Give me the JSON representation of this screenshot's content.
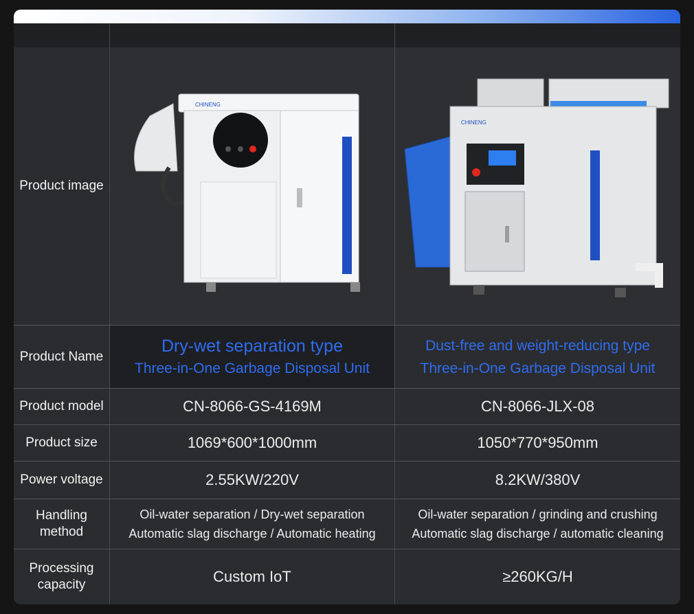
{
  "rows": {
    "image_label": "Product image",
    "name_label": "Product Name",
    "model_label": "Product model",
    "size_label": "Product size",
    "voltage_label": "Power voltage",
    "handling_label_line1": "Handling",
    "handling_label_line2": "method",
    "capacity_label_line1": "Processing",
    "capacity_label_line2": "capacity"
  },
  "products": [
    {
      "brand": "CHINENG",
      "name_line1": "Dry-wet separation type",
      "name_line2": "Three-in-One Garbage Disposal Unit",
      "model": "CN-8066-GS-4169M",
      "size": "1069*600*1000mm",
      "voltage": "2.55KW/220V",
      "handling_line1": "Oil-water separation / Dry-wet separation",
      "handling_line2": "Automatic slag discharge / Automatic heating",
      "capacity": "Custom IoT"
    },
    {
      "brand": "CHINENG",
      "name_line1": "Dust-free and weight-reducing type",
      "name_line2": "Three-in-One Garbage Disposal Unit",
      "model": "CN-8066-JLX-08",
      "size": "1050*770*950mm",
      "voltage": "8.2KW/380V",
      "handling_line1": "Oil-water separation / grinding and crushing",
      "handling_line2": "Automatic slag discharge / automatic cleaning",
      "capacity": "≥260KG/H"
    }
  ],
  "colors": {
    "accent": "#2f6df0",
    "background": "#2b2c2f",
    "text": "#ececec"
  }
}
